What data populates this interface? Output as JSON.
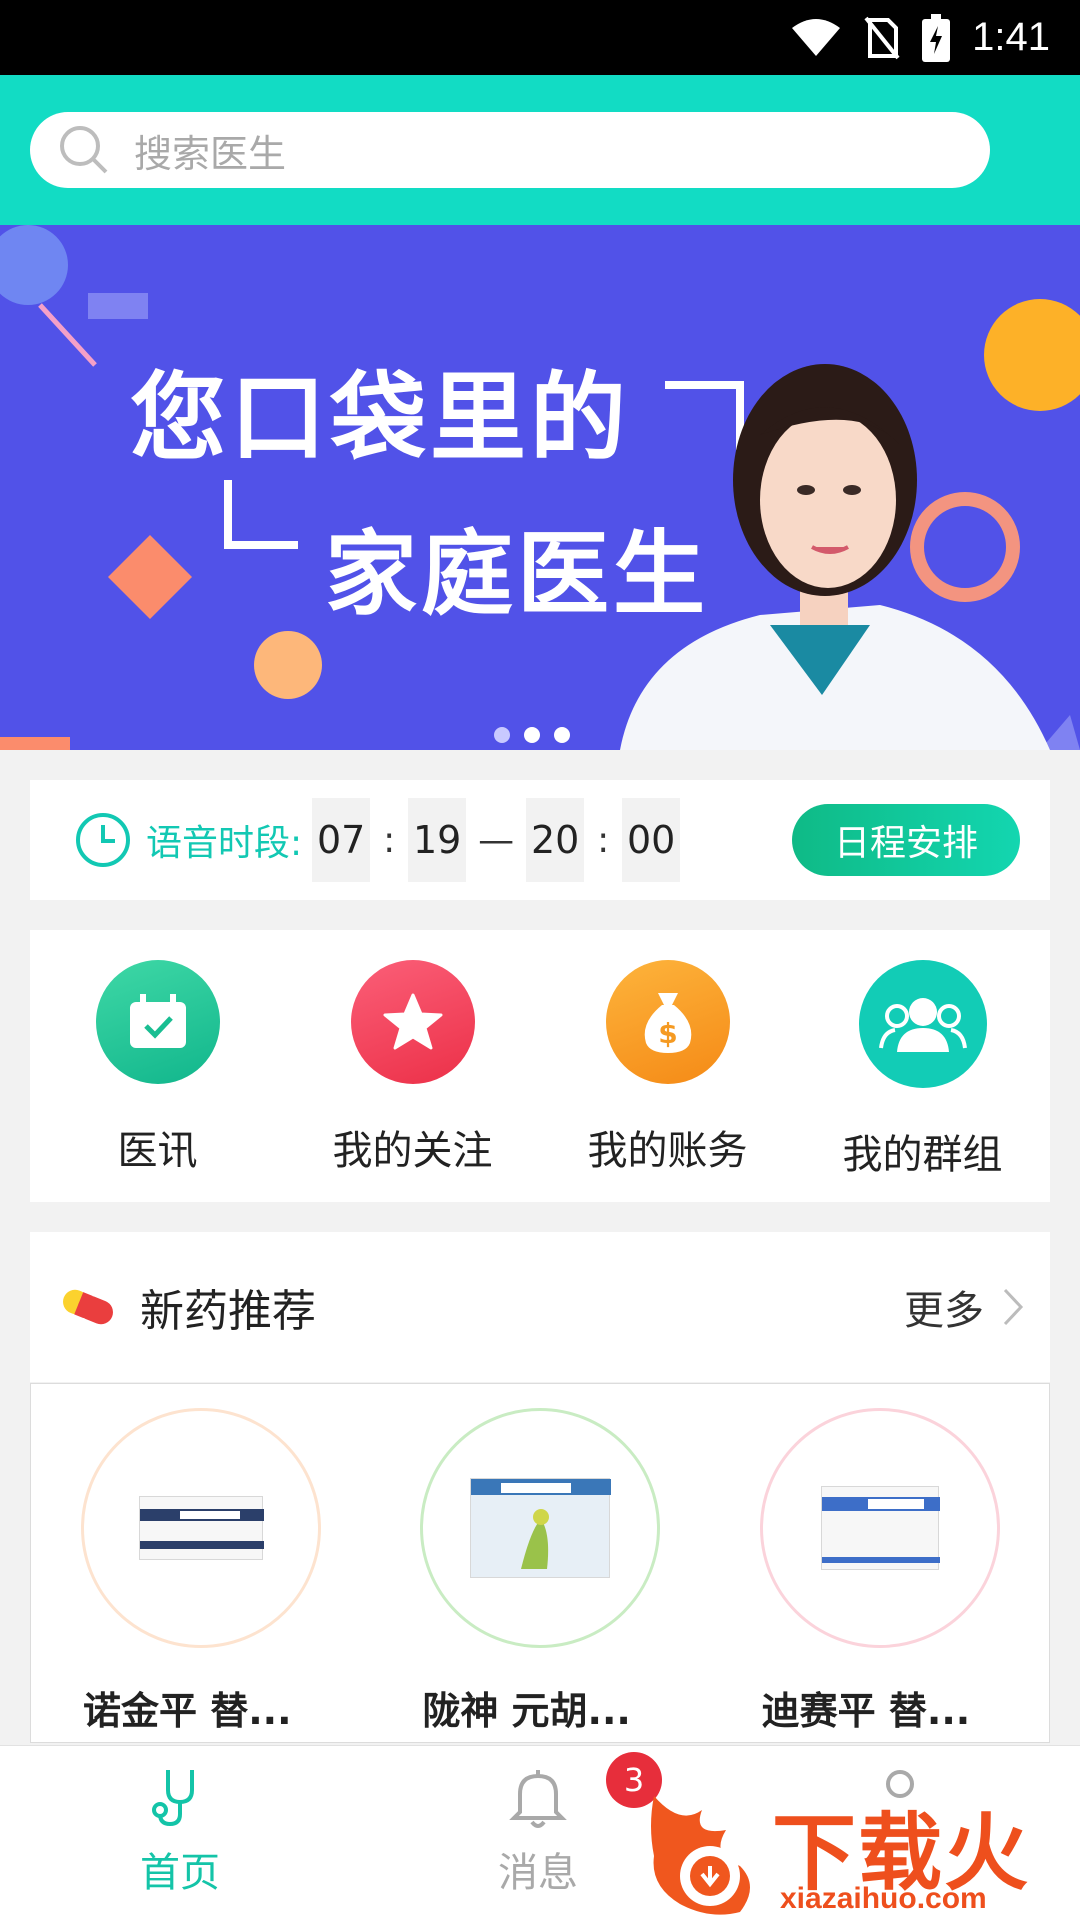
{
  "status_bar": {
    "time": "1:41"
  },
  "search": {
    "placeholder": "搜索医生"
  },
  "banner": {
    "line1": "您口袋里的",
    "line2": "家庭医生",
    "dots": 3,
    "active_dot": 2
  },
  "voice_slot": {
    "label": "语音时段:",
    "start_hour": "07",
    "start_minute": "19",
    "end_hour": "20",
    "end_minute": "00",
    "colon": ":",
    "dash": "—",
    "schedule_button": "日程安排"
  },
  "shortcuts": [
    {
      "label": "医讯",
      "icon": "calendar-check-icon",
      "color": "#1fc79a"
    },
    {
      "label": "我的关注",
      "icon": "star-icon",
      "color": "#f2405c"
    },
    {
      "label": "我的账务",
      "icon": "money-bag-icon",
      "color": "#f79d22"
    },
    {
      "label": "我的群组",
      "icon": "group-icon",
      "color": "#12ccb6"
    }
  ],
  "new_drugs": {
    "title": "新药推荐",
    "more": "更多",
    "items": [
      {
        "name": "诺金平 替...",
        "ring_color": "#fde3cf"
      },
      {
        "name": "陇神 元胡...",
        "ring_color": "#c9ecc3"
      },
      {
        "name": "迪赛平 替...",
        "ring_color": "#fbd3db"
      }
    ]
  },
  "bottom_nav": {
    "home": "首页",
    "messages": "消息",
    "message_badge": "3",
    "active_color": "#14c4a8"
  },
  "watermark": {
    "text": "下载火",
    "url": "xiazaihuo.com"
  }
}
